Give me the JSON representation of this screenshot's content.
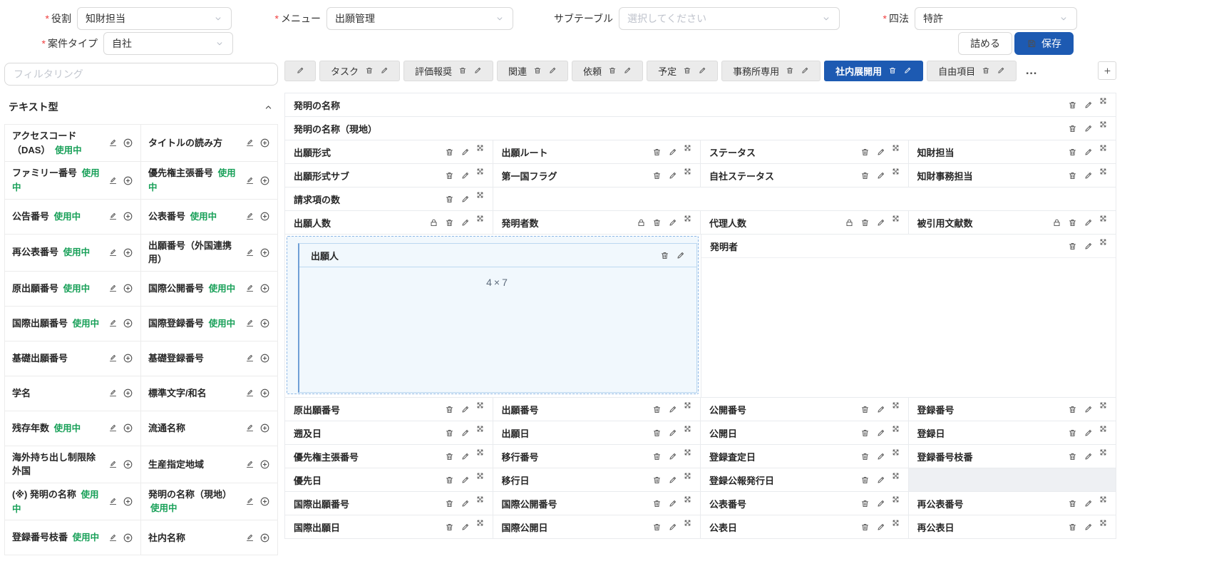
{
  "colors": {
    "accent": "#1d5ab2",
    "green": "#18a058"
  },
  "header": {
    "fields_row1": [
      {
        "id": "role",
        "label": "役割",
        "required": true,
        "value": "知財担当"
      },
      {
        "id": "menu",
        "label": "メニュー",
        "required": true,
        "value": "出願管理"
      },
      {
        "id": "subtable",
        "label": "サブテーブル",
        "required": false,
        "value": "",
        "placeholder": "選択してください"
      },
      {
        "id": "law",
        "label": "四法",
        "required": true,
        "value": "特許"
      }
    ],
    "fields_row2": [
      {
        "id": "case-type",
        "label": "案件タイプ",
        "required": true,
        "value": "自社"
      }
    ],
    "pack_button": "詰める",
    "save_button": "保存"
  },
  "sidebar": {
    "filter_placeholder": "フィルタリング",
    "section_title": "テキスト型",
    "in_use_label": "使用中",
    "items": [
      {
        "label": "アクセスコード（DAS）",
        "in_use": true
      },
      {
        "label": "タイトルの読み方",
        "in_use": false
      },
      {
        "label": "ファミリー番号",
        "in_use": true
      },
      {
        "label": "優先権主張番号",
        "in_use": true
      },
      {
        "label": "公告番号",
        "in_use": true
      },
      {
        "label": "公表番号",
        "in_use": true
      },
      {
        "label": "再公表番号",
        "in_use": true
      },
      {
        "label": "出願番号（外国連携用）",
        "in_use": false
      },
      {
        "label": "原出願番号",
        "in_use": true
      },
      {
        "label": "国際公開番号",
        "in_use": true
      },
      {
        "label": "国際出願番号",
        "in_use": true
      },
      {
        "label": "国際登録番号",
        "in_use": true
      },
      {
        "label": "基礎出願番号",
        "in_use": false
      },
      {
        "label": "基礎登録番号",
        "in_use": false
      },
      {
        "label": "学名",
        "in_use": false
      },
      {
        "label": "標準文字/和名",
        "in_use": false
      },
      {
        "label": "残存年数",
        "in_use": true
      },
      {
        "label": "流通名称",
        "in_use": false
      },
      {
        "label": "海外持ち出し制限除外国",
        "in_use": false
      },
      {
        "label": "生産指定地域",
        "in_use": false
      },
      {
        "label": "(※) 発明の名称",
        "in_use": true
      },
      {
        "label": "発明の名称（現地）",
        "in_use": true
      },
      {
        "label": "登録番号枝番",
        "in_use": true
      },
      {
        "label": "社内名称",
        "in_use": false
      }
    ]
  },
  "tabs": {
    "items": [
      {
        "label": "",
        "icons": [
          "edit"
        ],
        "active": false
      },
      {
        "label": "タスク",
        "icons": [
          "trash",
          "edit"
        ],
        "active": false
      },
      {
        "label": "評価報奨",
        "icons": [
          "trash",
          "edit"
        ],
        "active": false
      },
      {
        "label": "関連",
        "icons": [
          "trash",
          "edit"
        ],
        "active": false
      },
      {
        "label": "依頼",
        "icons": [
          "trash",
          "edit"
        ],
        "active": false
      },
      {
        "label": "予定",
        "icons": [
          "trash",
          "edit"
        ],
        "active": false
      },
      {
        "label": "事務所専用",
        "icons": [
          "trash",
          "edit"
        ],
        "active": false
      },
      {
        "label": "社内展開用",
        "icons": [
          "trash",
          "edit"
        ],
        "active": true
      },
      {
        "label": "自由項目",
        "icons": [
          "trash",
          "edit"
        ],
        "active": false
      }
    ],
    "more_label": "…"
  },
  "canvas": {
    "rows": [
      {
        "cells": [
          {
            "label": "発明の名称",
            "span": 4,
            "icons": [
              "trash",
              "edit",
              "expand"
            ]
          }
        ]
      },
      {
        "cells": [
          {
            "label": "発明の名称（現地）",
            "span": 4,
            "icons": [
              "trash",
              "edit",
              "expand"
            ]
          }
        ]
      },
      {
        "cells": [
          {
            "label": "出願形式",
            "icons": [
              "trash",
              "edit",
              "expand"
            ]
          },
          {
            "label": "出願ルート",
            "icons": [
              "trash",
              "edit",
              "expand"
            ]
          },
          {
            "label": "ステータス",
            "icons": [
              "trash",
              "edit",
              "expand"
            ]
          },
          {
            "label": "知財担当",
            "icons": [
              "trash",
              "edit",
              "expand"
            ]
          }
        ]
      },
      {
        "cells": [
          {
            "label": "出願形式サブ",
            "icons": [
              "trash",
              "edit",
              "expand"
            ]
          },
          {
            "label": "第一国フラグ",
            "icons": [
              "trash",
              "edit",
              "expand"
            ]
          },
          {
            "label": "自社ステータス",
            "icons": [
              "trash",
              "edit",
              "expand"
            ]
          },
          {
            "label": "知財事務担当",
            "icons": [
              "trash",
              "edit",
              "expand"
            ]
          }
        ]
      },
      {
        "cells": [
          {
            "label": "請求項の数",
            "icons": [
              "trash",
              "edit",
              "expand"
            ]
          },
          {
            "empty": true,
            "span": 3,
            "variant": "plain"
          }
        ]
      },
      {
        "cells": [
          {
            "label": "出願人数",
            "icons": [
              "lock",
              "trash",
              "edit",
              "expand"
            ]
          },
          {
            "label": "発明者数",
            "icons": [
              "lock",
              "trash",
              "edit",
              "expand"
            ]
          },
          {
            "label": "代理人数",
            "icons": [
              "lock",
              "trash",
              "edit",
              "expand"
            ]
          },
          {
            "label": "被引用文献数",
            "icons": [
              "lock",
              "trash",
              "edit",
              "expand"
            ]
          }
        ]
      },
      {
        "type": "blocks",
        "blocks": [
          {
            "label": "出願人",
            "selected": true,
            "size_label": "4×7",
            "icons": [
              "trash",
              "edit"
            ]
          },
          {
            "label": "発明者",
            "selected": false,
            "icons": [
              "trash",
              "edit",
              "expand"
            ]
          }
        ]
      },
      {
        "cells": [
          {
            "label": "原出願番号",
            "icons": [
              "trash",
              "edit",
              "expand"
            ]
          },
          {
            "label": "出願番号",
            "icons": [
              "trash",
              "edit",
              "expand"
            ]
          },
          {
            "label": "公開番号",
            "icons": [
              "trash",
              "edit",
              "expand"
            ]
          },
          {
            "label": "登録番号",
            "icons": [
              "trash",
              "edit",
              "expand"
            ]
          }
        ]
      },
      {
        "cells": [
          {
            "label": "遡及日",
            "icons": [
              "trash",
              "edit",
              "expand"
            ]
          },
          {
            "label": "出願日",
            "icons": [
              "trash",
              "edit",
              "expand"
            ]
          },
          {
            "label": "公開日",
            "icons": [
              "trash",
              "edit",
              "expand"
            ]
          },
          {
            "label": "登録日",
            "icons": [
              "trash",
              "edit",
              "expand"
            ]
          }
        ]
      },
      {
        "cells": [
          {
            "label": "優先権主張番号",
            "icons": [
              "trash",
              "edit",
              "expand"
            ]
          },
          {
            "label": "移行番号",
            "icons": [
              "trash",
              "edit",
              "expand"
            ]
          },
          {
            "label": "登録査定日",
            "icons": [
              "trash",
              "edit",
              "expand"
            ]
          },
          {
            "label": "登録番号枝番",
            "icons": [
              "trash",
              "edit",
              "expand"
            ]
          }
        ]
      },
      {
        "cells": [
          {
            "label": "優先日",
            "icons": [
              "trash",
              "edit",
              "expand"
            ]
          },
          {
            "label": "移行日",
            "icons": [
              "trash",
              "edit",
              "expand"
            ]
          },
          {
            "label": "登録公報発行日",
            "icons": [
              "trash",
              "edit",
              "expand"
            ]
          },
          {
            "empty": true,
            "span": 1,
            "variant": "gray"
          }
        ]
      },
      {
        "cells": [
          {
            "label": "国際出願番号",
            "icons": [
              "trash",
              "edit",
              "expand"
            ]
          },
          {
            "label": "国際公開番号",
            "icons": [
              "trash",
              "edit",
              "expand"
            ]
          },
          {
            "label": "公表番号",
            "icons": [
              "trash",
              "edit",
              "expand"
            ]
          },
          {
            "label": "再公表番号",
            "icons": [
              "trash",
              "edit",
              "expand"
            ]
          }
        ]
      },
      {
        "cells": [
          {
            "label": "国際出願日",
            "icons": [
              "trash",
              "edit",
              "expand"
            ]
          },
          {
            "label": "国際公開日",
            "icons": [
              "trash",
              "edit",
              "expand"
            ]
          },
          {
            "label": "公表日",
            "icons": [
              "trash",
              "edit",
              "expand"
            ]
          },
          {
            "label": "再公表日",
            "icons": [
              "trash",
              "edit",
              "expand"
            ]
          }
        ]
      }
    ]
  }
}
